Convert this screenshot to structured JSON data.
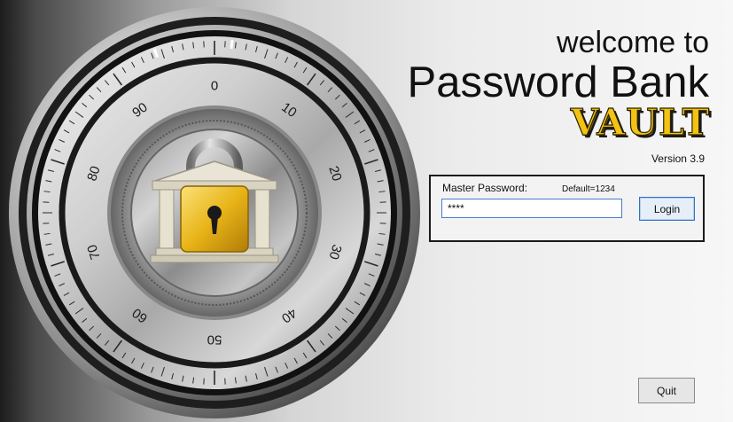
{
  "header": {
    "welcome_text": "welcome to",
    "app_name": "Password Bank",
    "vault_text": "VAULT",
    "version": "Version 3.9"
  },
  "dial": {
    "numbers": [
      "0",
      "10",
      "20",
      "30",
      "40",
      "50",
      "60",
      "70",
      "80",
      "90"
    ],
    "lock_icon": "padlock-bank-icon"
  },
  "login": {
    "label": "Master Password:",
    "default_hint": "Default=1234",
    "password_value": "****",
    "login_label": "Login"
  },
  "quit_label": "Quit",
  "colors": {
    "vault_gold": "#f2c314",
    "lock_gold": "#e8b418",
    "focus_border": "#2e72c4"
  }
}
